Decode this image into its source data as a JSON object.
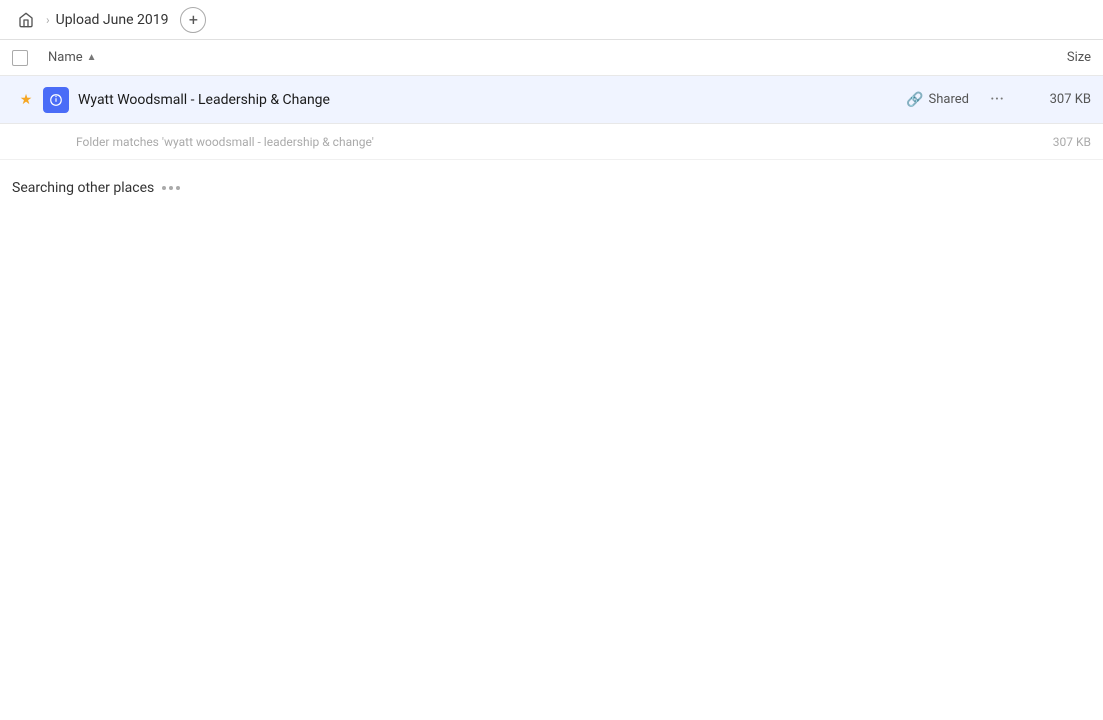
{
  "header": {
    "home_label": "home",
    "breadcrumb_title": "Upload June 2019",
    "new_btn_label": "+"
  },
  "columns": {
    "name_label": "Name",
    "size_label": "Size"
  },
  "file_row": {
    "name": "Wyatt Woodsmall - Leadership & Change",
    "shared_label": "Shared",
    "size": "307 KB",
    "folder_match_text": "Folder matches 'wyatt woodsmall - leadership & change'",
    "folder_match_size": "307 KB"
  },
  "searching": {
    "text": "Searching other places"
  }
}
